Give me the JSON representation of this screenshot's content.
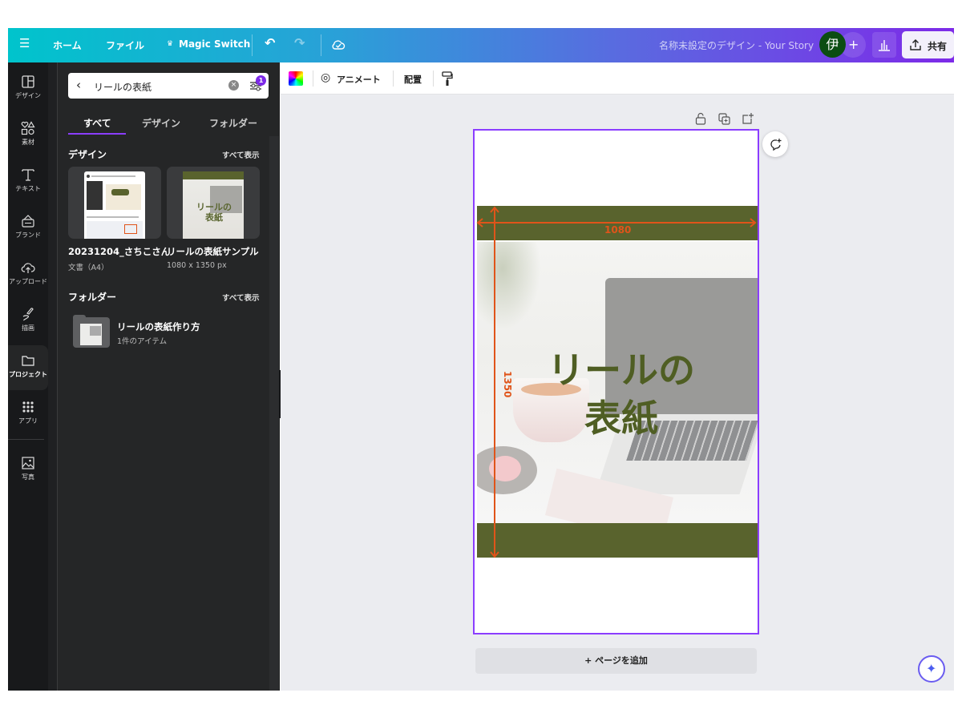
{
  "topbar": {
    "menu_icon": "hamburger-icon",
    "home": "ホーム",
    "file": "ファイル",
    "magic_switch": "Magic Switch",
    "design_title": "名称未設定のデザイン - Your Story",
    "avatar_initial": "伊",
    "share": "共有",
    "gradient_start": "#00c4cc",
    "gradient_end": "#7d2ae8"
  },
  "rail": {
    "items": [
      {
        "label": "デザイン",
        "icon": "layout-icon"
      },
      {
        "label": "素材",
        "icon": "elements-icon"
      },
      {
        "label": "テキスト",
        "icon": "text-icon"
      },
      {
        "label": "ブランド",
        "icon": "brand-icon"
      },
      {
        "label": "アップロード",
        "icon": "upload-cloud-icon"
      },
      {
        "label": "描画",
        "icon": "draw-icon"
      },
      {
        "label": "プロジェクト",
        "icon": "folder-icon",
        "selected": true
      },
      {
        "label": "アプリ",
        "icon": "apps-grid-icon"
      },
      {
        "label": "写真",
        "icon": "photo-icon"
      }
    ]
  },
  "panel": {
    "search": {
      "value": "リールの表紙",
      "filter_badge": "1"
    },
    "tabs": [
      {
        "label": "すべて",
        "active": true
      },
      {
        "label": "デザイン"
      },
      {
        "label": "フォルダー"
      }
    ],
    "designs_heading": "デザイン",
    "designs_more": "すべて表示",
    "designs": [
      {
        "title": "20231204_さちこさん",
        "subtitle": "文書（A4）"
      },
      {
        "title": "リールの表紙サンプル",
        "subtitle": "1080 x 1350 px",
        "thumb_text": "リールの\n表紙"
      }
    ],
    "folders_heading": "フォルダー",
    "folders_more": "すべて表示",
    "folders": [
      {
        "title": "リールの表紙作り方",
        "subtitle": "1件のアイテム"
      }
    ]
  },
  "toolbar": {
    "animate": "アニメート",
    "position": "配置"
  },
  "canvas": {
    "headline_line1": "リールの",
    "headline_line2": "表紙",
    "width_label": "1080",
    "height_label": "1350",
    "add_page": "+ ページを追加",
    "band_color": "#59632d",
    "text_color": "#4f5e23",
    "selection_color": "#8b3dff",
    "measure_color": "#e0541a"
  }
}
